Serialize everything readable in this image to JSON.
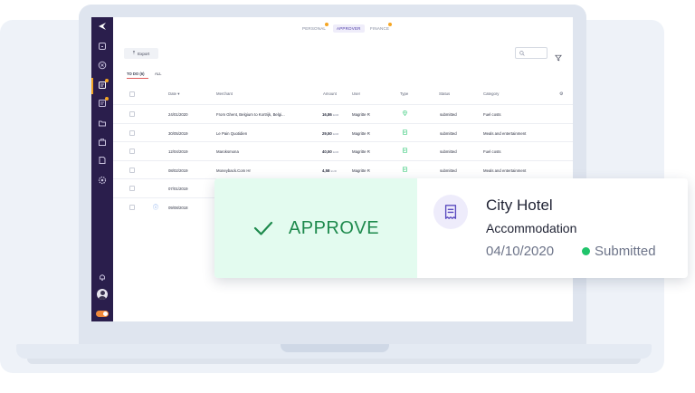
{
  "tabs": [
    "PERSONAL",
    "APPROVER",
    "FINANCE"
  ],
  "active_tab": "APPROVER",
  "toolbar": {
    "export_label": "Export"
  },
  "subtabs": {
    "todo": "TO DO (6)",
    "all": "ALL"
  },
  "columns": [
    "Date",
    "Merchant",
    "Amount",
    "User",
    "Type",
    "Status",
    "Category"
  ],
  "rows": [
    {
      "date": "24/01/2020",
      "merchant": "From Ghent, Belgium to Kortrijk, Belgi...",
      "amount": "16,86",
      "currency": "EUR",
      "user": "Magritte R",
      "type": "mileage-pin-icon",
      "status": "submitted",
      "category": "Fuel costs"
    },
    {
      "date": "30/05/2019",
      "merchant": "Le Pain Quotidien",
      "amount": "29,50",
      "currency": "EUR",
      "user": "Magritte R",
      "type": "receipt-icon",
      "status": "submitted",
      "category": "Meals and entertainment"
    },
    {
      "date": "12/04/2019",
      "merchant": "Maroksmona",
      "amount": "40,50",
      "currency": "EUR",
      "user": "Magritte R",
      "type": "receipt-icon",
      "status": "submitted",
      "category": "Fuel costs"
    },
    {
      "date": "08/02/2019",
      "merchant": "Moneyback.Com Hr",
      "amount": "4,58",
      "currency": "EUR",
      "user": "Magritte R",
      "type": "receipt-icon",
      "status": "submitted",
      "category": "Meals and entertainment"
    },
    {
      "date": "07/01/2019",
      "merchant": "",
      "amount": "",
      "currency": "",
      "user": "",
      "type": "",
      "status": "",
      "category": ""
    },
    {
      "date": "09/08/2018",
      "merchant": "",
      "amount": "",
      "currency": "",
      "user": "",
      "type": "",
      "status": "",
      "category": ""
    }
  ],
  "card": {
    "action_label": "APPROVE",
    "title": "City Hotel",
    "category": "Accommodation",
    "date": "04/10/2020",
    "status": "Submitted"
  },
  "colors": {
    "sidebar": "#2a1e4c",
    "accent": "#f5a623",
    "approve_bg": "#e3fbef",
    "approve_text": "#1e8a4d",
    "status_green": "#20c46b",
    "primary": "#4b3aa6"
  }
}
